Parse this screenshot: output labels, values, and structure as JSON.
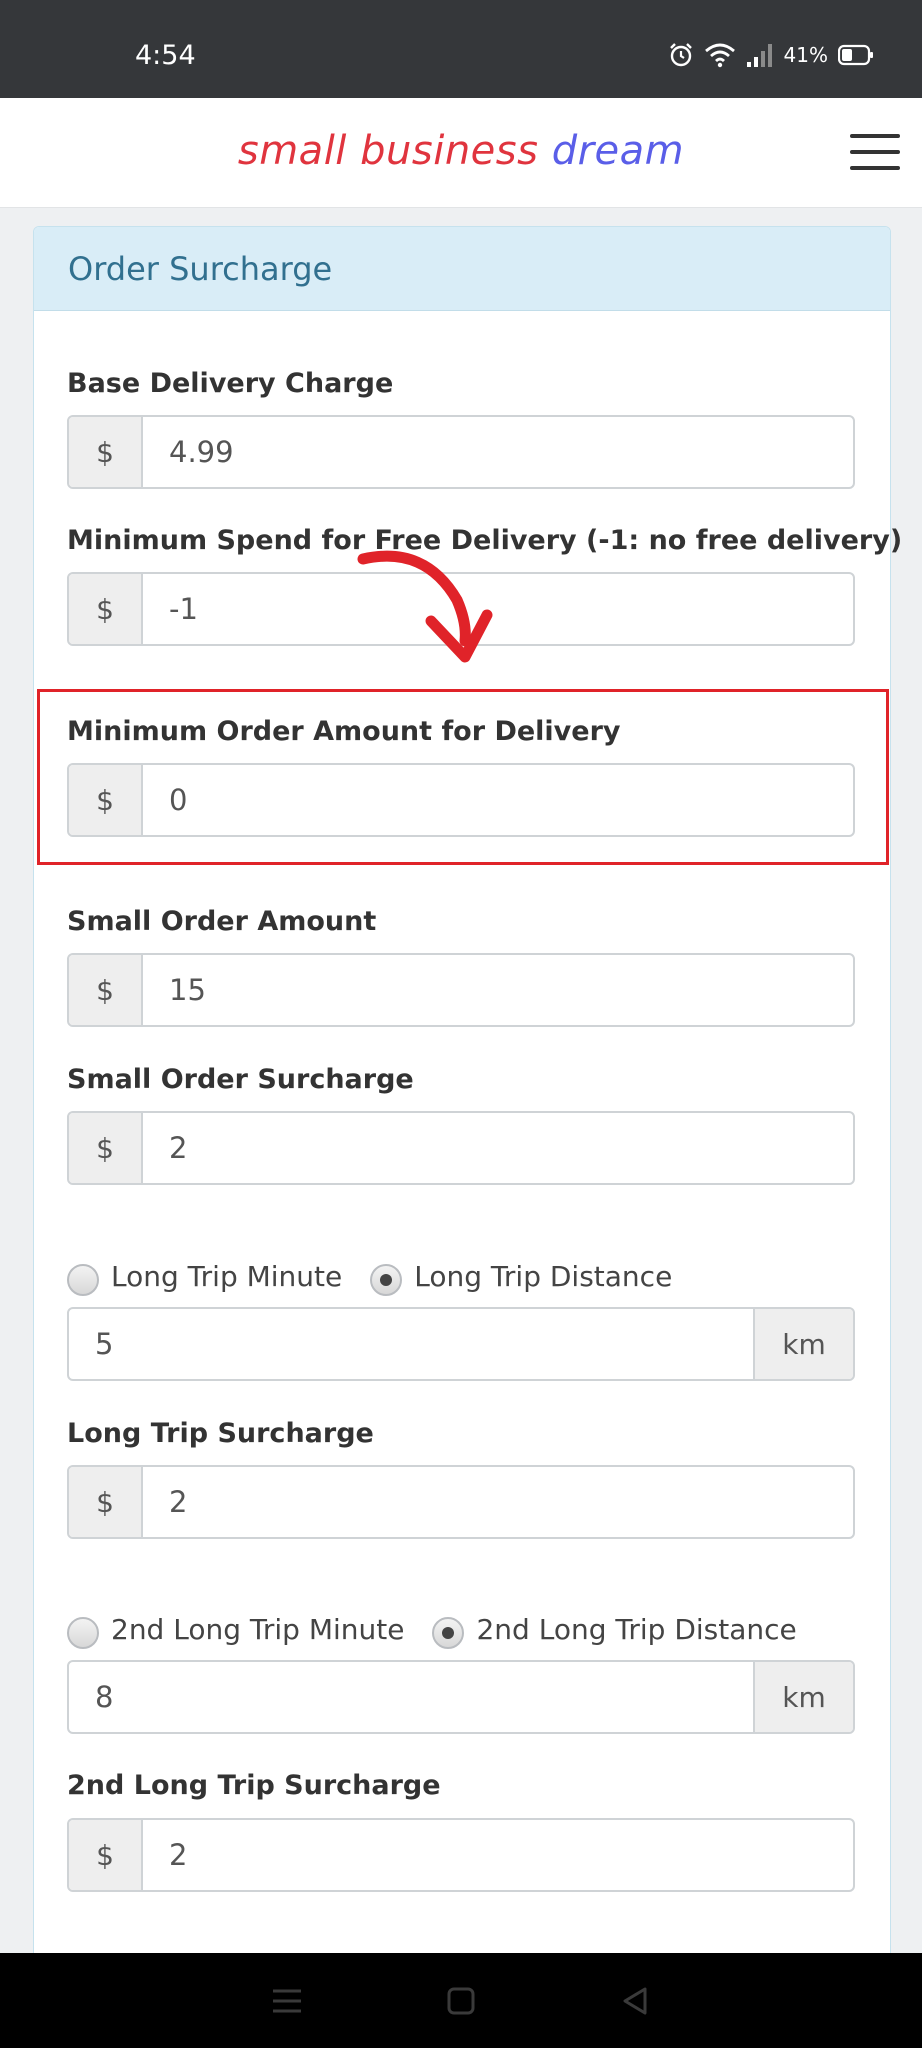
{
  "status_bar": {
    "time": "4:54",
    "battery": "41%",
    "icons": [
      "alarm-icon",
      "wifi-icon",
      "signal-icon",
      "battery-icon"
    ]
  },
  "header": {
    "brand_part1": "small business",
    "brand_part2": "dream",
    "brand_colors": {
      "part1": "#e0343e",
      "part2": "#5a5ee8"
    },
    "menu_icon": "hamburger-menu-icon"
  },
  "panel": {
    "title": "Order Surcharge"
  },
  "fields": {
    "base_delivery": {
      "label": "Base Delivery Charge",
      "addon": "$",
      "value": "4.99"
    },
    "min_spend_free": {
      "label": "Minimum Spend for Free Delivery (-1: no free delivery)",
      "addon": "$",
      "value": "-1"
    },
    "min_order_delivery": {
      "label": "Minimum Order Amount for Delivery",
      "addon": "$",
      "value": "0"
    },
    "small_order_amount": {
      "label": "Small Order Amount",
      "addon": "$",
      "value": "15"
    },
    "small_order_surcharge": {
      "label": "Small Order Surcharge",
      "addon": "$",
      "value": "2"
    },
    "long_trip": {
      "option_minute": "Long Trip Minute",
      "option_distance": "Long Trip Distance",
      "selected": "distance",
      "value": "5",
      "unit": "km"
    },
    "long_trip_surcharge": {
      "label": "Long Trip Surcharge",
      "addon": "$",
      "value": "2"
    },
    "second_long_trip": {
      "option_minute": "2nd Long Trip Minute",
      "option_distance": "2nd Long Trip Distance",
      "selected": "distance",
      "value": "8",
      "unit": "km"
    },
    "second_long_trip_surcharge": {
      "label": "2nd Long Trip Surcharge",
      "addon": "$",
      "value": "2"
    }
  },
  "annotation": {
    "highlight_color": "#e02329"
  },
  "nav_bar": {
    "icons": [
      "menu-lines-icon",
      "home-square-icon",
      "back-triangle-icon"
    ]
  }
}
